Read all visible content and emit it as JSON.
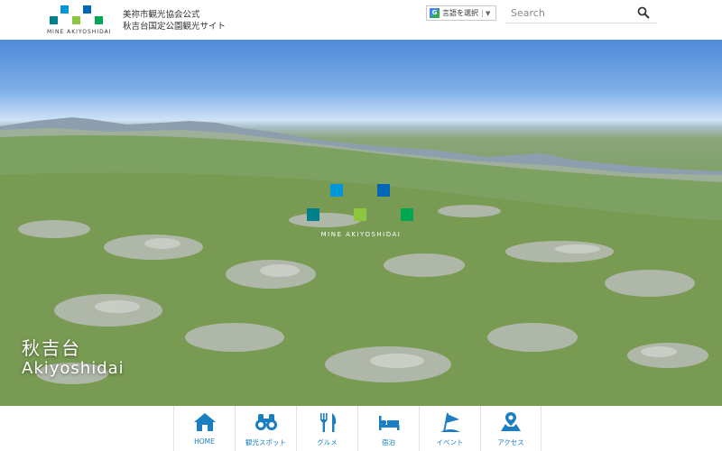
{
  "header": {
    "logo_caption": "MINE AKIYOSHIDAI",
    "title_line1": "美祢市観光協会公式",
    "title_line2": "秋吉台国定公園観光サイト",
    "language_label": "言語を選択",
    "search_placeholder": "Search"
  },
  "hero": {
    "logo_caption": "MINE AKIYOSHIDAI",
    "name_jp": "秋吉台",
    "name_en": "Akiyoshidai"
  },
  "nav": [
    {
      "label": "HOME",
      "icon": "home-icon"
    },
    {
      "label": "観光スポット",
      "icon": "binoculars-icon"
    },
    {
      "label": "グルメ",
      "icon": "fork-knife-icon"
    },
    {
      "label": "宿泊",
      "icon": "bed-icon"
    },
    {
      "label": "イベント",
      "icon": "flag-icon"
    },
    {
      "label": "アクセス",
      "icon": "map-pin-icon"
    }
  ],
  "colors": {
    "accent_blue": "#1a7ec0",
    "logo_blue": "#0097d8",
    "logo_teal": "#00808a",
    "logo_lime": "#8cc63f",
    "logo_green": "#00a650",
    "logo_navy": "#0068b7"
  }
}
